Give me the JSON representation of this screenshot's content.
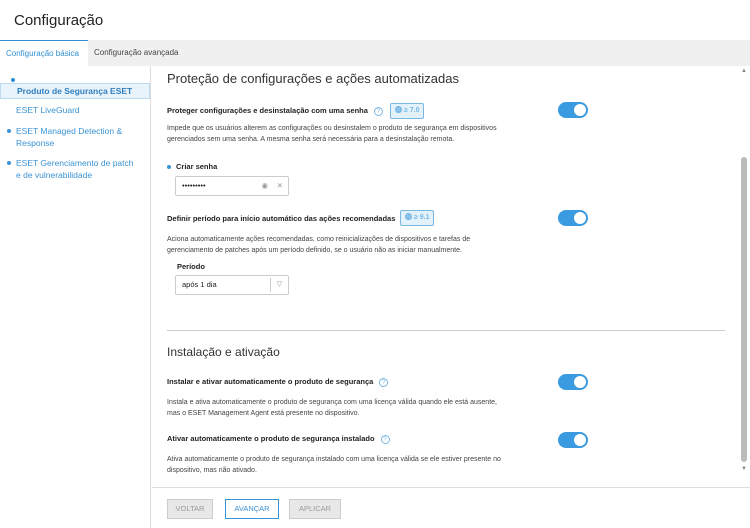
{
  "title": "Configuração",
  "tabs": [
    {
      "label": "Configuração básica"
    },
    {
      "label": "Configuração avançada"
    }
  ],
  "sidebar": [
    {
      "label": "Produto de Segurança ESET"
    },
    {
      "label": "ESET LiveGuard"
    },
    {
      "label": "ESET Managed Detection & Response"
    },
    {
      "label": "ESET Gerenciamento de patch e de vulnerabilidade"
    }
  ],
  "section1": {
    "heading": "Proteção de configurações e ações automatizadas",
    "item1": {
      "label": "Proteger configurações e desinstalação com uma senha",
      "badge": "≥ 7.0",
      "enabled": true,
      "desc": "Impede que os usuários alterem as configurações ou desinstalem o produto de segurança em dispositivos gerenciados sem uma senha. A mesma senha será necessária para a desinstalação remota.",
      "field_label": "Criar senha",
      "field_value": "•••••••••"
    },
    "item2": {
      "label": "Definir período para início automático das ações recomendadas",
      "badge": "≥ 9.1",
      "enabled": true,
      "desc": "Aciona automaticamente ações recomendadas, como reinicializações de dispositivos e tarefas de gerenciamento de patches após um período definido, se o usuário não as iniciar manualmente.",
      "field_label": "Período",
      "field_value": "após 1 dia"
    }
  },
  "section2": {
    "heading": "Instalação e ativação",
    "item3": {
      "label": "Instalar e ativar automaticamente o produto de segurança",
      "enabled": true,
      "desc": "Instala e ativa automaticamente o produto de segurança com uma licença válida quando ele está ausente, mas o ESET Management Agent está presente no dispositivo."
    },
    "item4": {
      "label": "Ativar automaticamente o produto de segurança instalado",
      "enabled": true,
      "desc": "Ativa automaticamente o produto de segurança instalado com uma licença válida se ele estiver presente no dispositivo, mas não ativado."
    }
  },
  "buttons": {
    "back": "VOLTAR",
    "next": "AVANÇAR",
    "apply": "APLICAR"
  },
  "help": "?"
}
